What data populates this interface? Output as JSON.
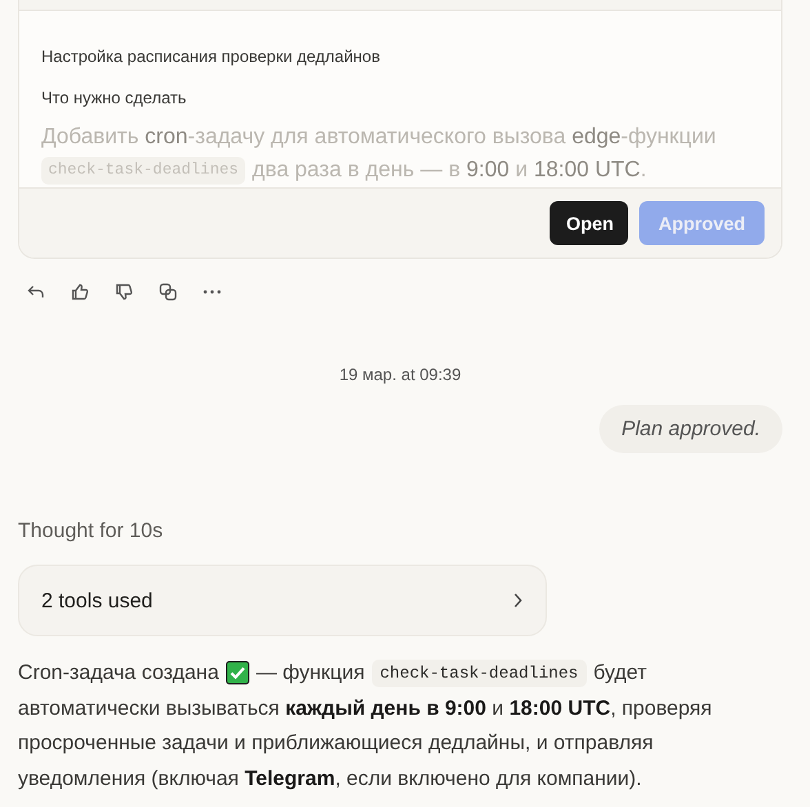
{
  "plan_card": {
    "title": "Настройка расписания проверки дедлайнов",
    "section": "Что нужно сделать",
    "preview": [
      [
        {
          "kind": "text",
          "text": "Добавить **cron**-задачу для автоматического вызова **edge**-функции"
        }
      ],
      [
        {
          "kind": "code",
          "text": "check-task-deadlines"
        },
        {
          "kind": "text",
          "text": "два раза в день — в **9:00** и **18:00 UTC**."
        }
      ]
    ],
    "buttons": [
      {
        "label": "Open",
        "kind": "dark",
        "disabled": false
      },
      {
        "label": "Approved",
        "kind": "accent",
        "disabled": true
      }
    ]
  },
  "timestamp": "19 мар. at 09:39",
  "user_message": "Plan approved.",
  "thought": "Thought for 10s",
  "tools_card": {
    "label": "2 tools used",
    "expanded": false
  },
  "answer": [
    [
      {
        "kind": "text",
        "text": "Cron-задача создана"
      },
      {
        "kind": "check"
      },
      {
        "kind": "text",
        "text": "— функция"
      },
      {
        "kind": "code",
        "text": "check-task-deadlines"
      },
      {
        "kind": "text",
        "text": "будет"
      }
    ],
    [
      {
        "kind": "text",
        "text": "автоматически вызываться **каждый день в 9:00** и **18:00 UTC**, проверяя"
      }
    ],
    [
      {
        "kind": "text",
        "text": "просроченные задачи и приближающиеся дедлайны, и отправляя"
      }
    ],
    [
      {
        "kind": "text",
        "text": "уведомления (включая **Telegram**, если включено для компании)."
      }
    ]
  ]
}
